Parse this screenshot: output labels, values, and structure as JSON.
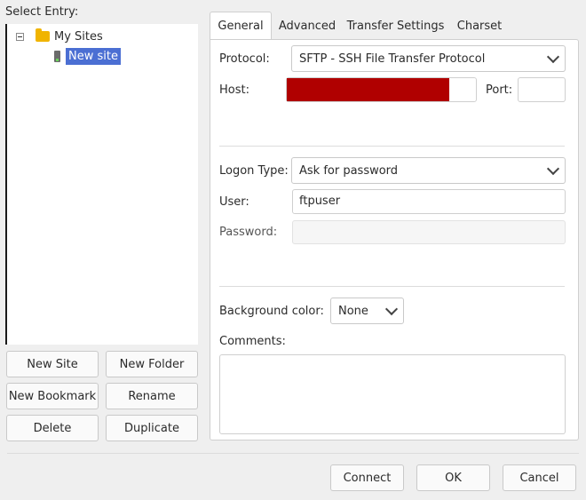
{
  "left": {
    "select_entry_label": "Select Entry:",
    "tree": {
      "folder_label": "My Sites",
      "site_label": "New site"
    },
    "buttons": {
      "new_site": "New Site",
      "new_folder": "New Folder",
      "new_bookmark": "New Bookmark",
      "rename": "Rename",
      "delete": "Delete",
      "duplicate": "Duplicate"
    }
  },
  "tabs": [
    "General",
    "Advanced",
    "Transfer Settings",
    "Charset"
  ],
  "general": {
    "protocol_label": "Protocol:",
    "protocol_value": "SFTP - SSH File Transfer Protocol",
    "host_label": "Host:",
    "host_value": "",
    "port_label": "Port:",
    "port_value": "",
    "logon_type_label": "Logon Type:",
    "logon_type_value": "Ask for password",
    "user_label": "User:",
    "user_value": "ftpuser",
    "password_label": "Password:",
    "password_value": "",
    "background_color_label": "Background color:",
    "background_color_value": "None",
    "comments_label": "Comments:",
    "comments_value": ""
  },
  "footer": {
    "connect": "Connect",
    "ok": "OK",
    "cancel": "Cancel"
  },
  "colors": {
    "selection": "#4b6fd3",
    "redaction": "#b00000",
    "folder": "#f0b400"
  }
}
